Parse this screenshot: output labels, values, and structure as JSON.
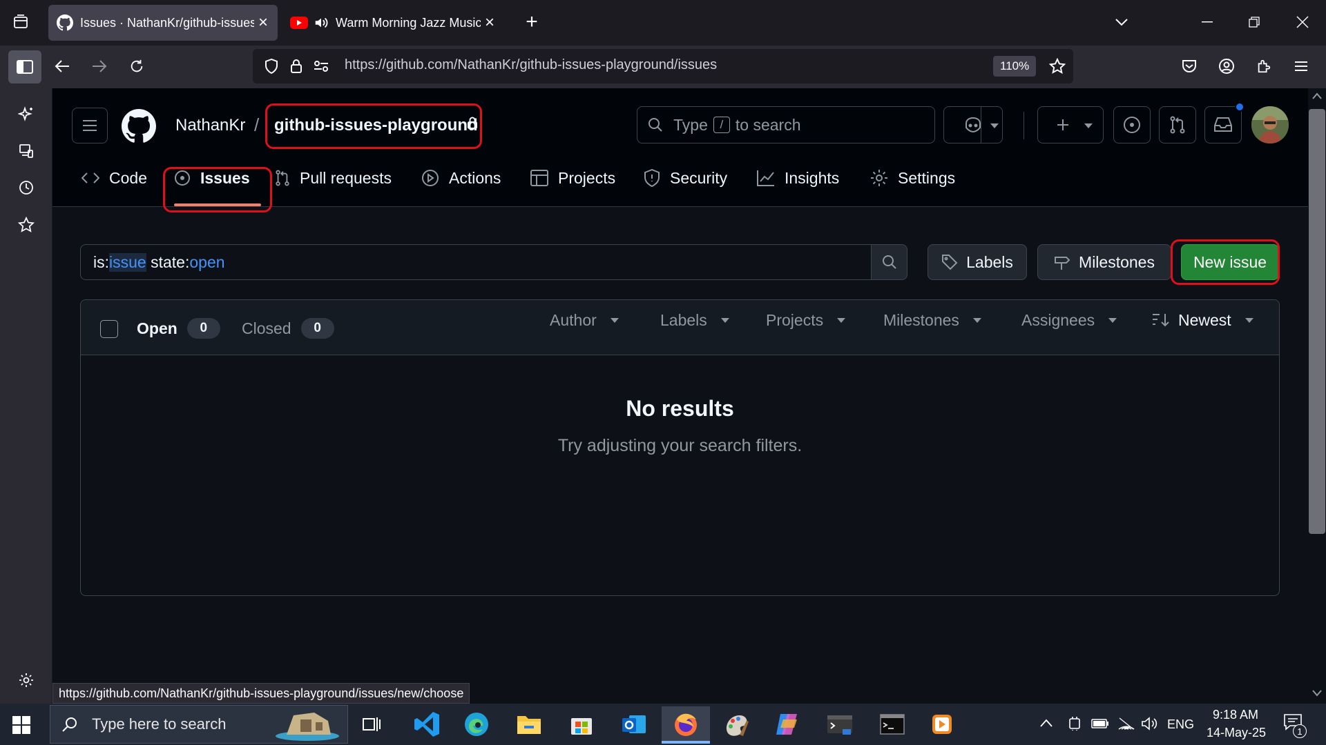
{
  "browser": {
    "tabs": [
      {
        "title": "Issues · NathanKr/github-issues-playground",
        "active": true,
        "close": "×"
      },
      {
        "title": "Warm Morning Jazz Music & Relaxing Coffee",
        "active": false,
        "close": "×"
      }
    ],
    "new_tab": "+",
    "url": "https://github.com/NathanKr/github-issues-playground/issues",
    "zoom": "110%",
    "status_url": "https://github.com/NathanKr/github-issues-playground/issues/new/choose"
  },
  "github": {
    "owner": "NathanKr",
    "separator": "/",
    "repo": "github-issues-playground",
    "search_placeholder_pre": "Type",
    "search_key": "/",
    "search_placeholder_post": "to search",
    "tabs": [
      {
        "label": "Code",
        "icon": "code-icon"
      },
      {
        "label": "Issues",
        "icon": "issue-opened-icon",
        "selected": true
      },
      {
        "label": "Pull requests",
        "icon": "git-pull-request-icon"
      },
      {
        "label": "Actions",
        "icon": "play-icon"
      },
      {
        "label": "Projects",
        "icon": "table-icon"
      },
      {
        "label": "Security",
        "icon": "shield-icon"
      },
      {
        "label": "Insights",
        "icon": "graph-icon"
      },
      {
        "label": "Settings",
        "icon": "gear-icon"
      }
    ],
    "issue_search": {
      "t1": "is:",
      "v1": "issue",
      "t2": " state:",
      "v2": "open"
    },
    "labels_button": "Labels",
    "milestones_button": "Milestones",
    "new_issue_button": "New issue",
    "list": {
      "open_label": "Open",
      "open_count": "0",
      "closed_label": "Closed",
      "closed_count": "0",
      "filters": [
        "Author",
        "Labels",
        "Projects",
        "Milestones",
        "Assignees"
      ],
      "sort": "Newest",
      "empty_title": "No results",
      "empty_subtitle": "Try adjusting your search filters."
    },
    "accent_colors": {
      "green": "#238636",
      "link": "#4493f8",
      "highlight": "#e0101a"
    }
  },
  "taskbar": {
    "search_placeholder": "Type here to search",
    "language": "ENG",
    "time": "9:18 AM",
    "date": "14-May-25",
    "notification_count": "1"
  }
}
